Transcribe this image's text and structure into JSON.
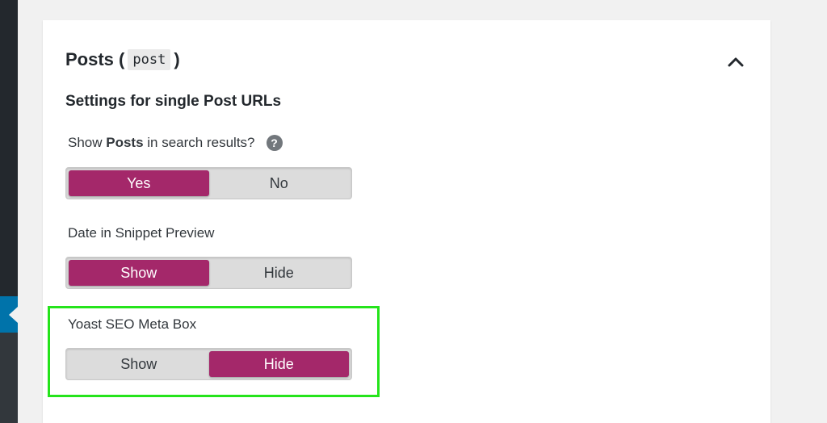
{
  "panel": {
    "title_prefix": "Posts (",
    "title_code": "post",
    "title_suffix": ")",
    "collapse_icon": "chevron-up-icon",
    "section_heading": "Settings for single Post URLs"
  },
  "fields": {
    "search_results": {
      "label_prefix": "Show ",
      "label_bold": "Posts",
      "label_suffix": " in search results?",
      "help": "?",
      "options": [
        "Yes",
        "No"
      ],
      "selected": "Yes"
    },
    "date_snippet": {
      "label": "Date in Snippet Preview",
      "options": [
        "Show",
        "Hide"
      ],
      "selected": "Show"
    },
    "meta_box": {
      "label": "Yoast SEO Meta Box",
      "options": [
        "Show",
        "Hide"
      ],
      "selected": "Hide"
    }
  },
  "colors": {
    "accent": "#a4286a",
    "highlight": "#25e41b",
    "admin_sidebar": "#23282d",
    "admin_active": "#0073aa"
  }
}
